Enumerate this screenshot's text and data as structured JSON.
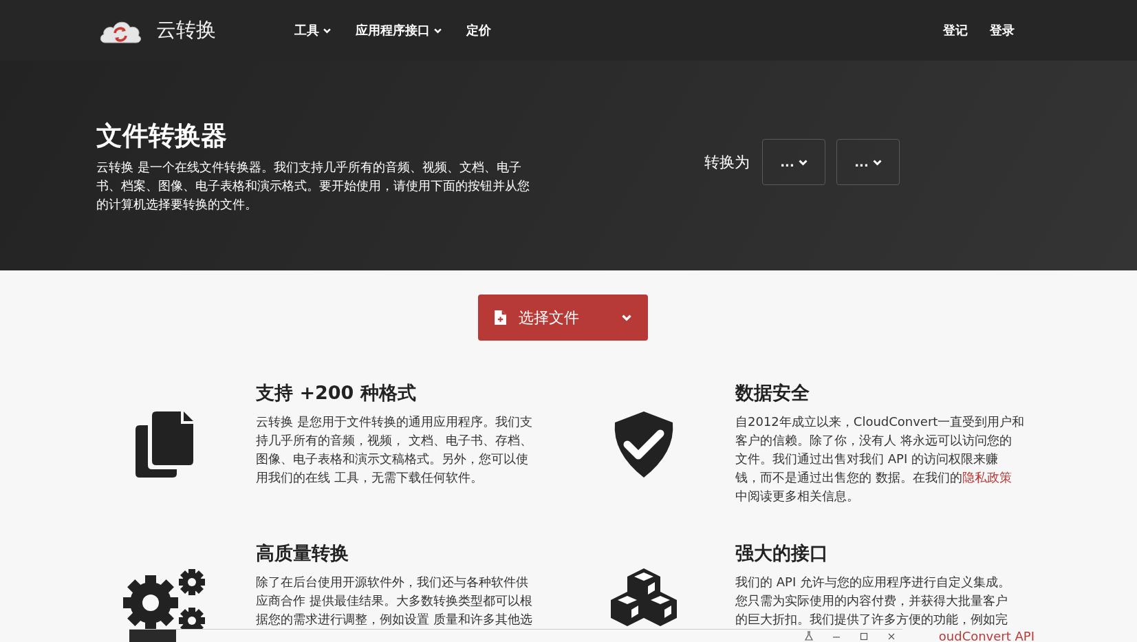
{
  "nav": {
    "brand": "云转换",
    "menu": [
      {
        "label": "工具",
        "dropdown": true
      },
      {
        "label": "应用程序接口",
        "dropdown": true
      },
      {
        "label": "定价",
        "dropdown": false
      }
    ],
    "account": [
      "登记",
      "登录"
    ]
  },
  "hero": {
    "title": "文件转换器",
    "text": "云转换 是一个在线文件转换器。我们支持几乎所有的音频、视频、文档、电子书、档案、图像、电子表格和演示格式。要开始使用，请使用下面的按钮并从您的计算机选择要转换的文件。",
    "convert_label": "转换为",
    "selects": [
      "...",
      "..."
    ]
  },
  "upload_button": {
    "label": "选择文件"
  },
  "features": [
    {
      "kind": "files",
      "title": "支持 +200 种格式",
      "lines": [
        "云转换 是您用于文件转换的通用应用程序。我们支",
        "持几乎所有的音频，视频， 文档、电子书、存档、",
        "图像、电子表格和演示文稿格式。另外，您可以使",
        "用我们的在线 工具，无需下载任何软件。"
      ]
    },
    {
      "kind": "shield",
      "title": "数据安全",
      "lines": [
        "自2012年成立以来，CloudConvert一直受到用户和",
        "客户的信赖。除了你，没有人 将永远可以访问您的",
        "文件。我们通过出售对我们 API 的访问权限来赚",
        {
          "text": "钱，而不是通过出售您的 数据。在我们的",
          "link": "隐私政策"
        },
        "中阅读更多相关信息。"
      ]
    },
    {
      "kind": "gears",
      "title": "高质量转换",
      "lines": [
        "除了在后台使用开源软件外，我们还与各种软件供",
        "应商合作 提供最佳结果。大多数转换类型都可以根",
        "据您的需求进行调整，例如设置 质量和许多其他选"
      ]
    },
    {
      "kind": "cubes",
      "title": "强大的接口",
      "lines": [
        "我们的 API 允许与您的应用程序进行自定义集成。",
        "您只需为实际使用的内容付费，并获得大批量客户",
        "的巨大折扣。我们提供了许多方便的功能，例如完",
        {
          "link": "oudConvert API"
        }
      ]
    }
  ]
}
